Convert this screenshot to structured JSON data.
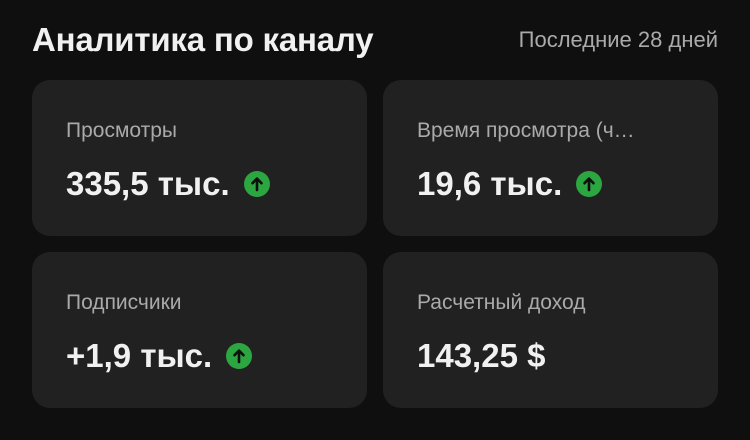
{
  "header": {
    "title": "Аналитика по каналу",
    "period": "Последние 28 дней"
  },
  "metrics": [
    {
      "label": "Просмотры",
      "value": "335,5 тыс.",
      "trend": "up",
      "trend_icon": "arrow-up-icon"
    },
    {
      "label": "Время просмотра (ч…",
      "value": "19,6 тыс.",
      "trend": "up",
      "trend_icon": "arrow-up-icon"
    },
    {
      "label": "Подписчики",
      "value": "+1,9 тыс.",
      "trend": "up",
      "trend_icon": "arrow-up-icon"
    },
    {
      "label": "Расчетный доход",
      "value": "143,25 $",
      "trend": "none"
    }
  ],
  "colors": {
    "background": "#0f0f0f",
    "card": "#212121",
    "text_primary": "#f1f1f1",
    "text_secondary": "#aaaaaa",
    "trend_up": "#2ba640"
  }
}
